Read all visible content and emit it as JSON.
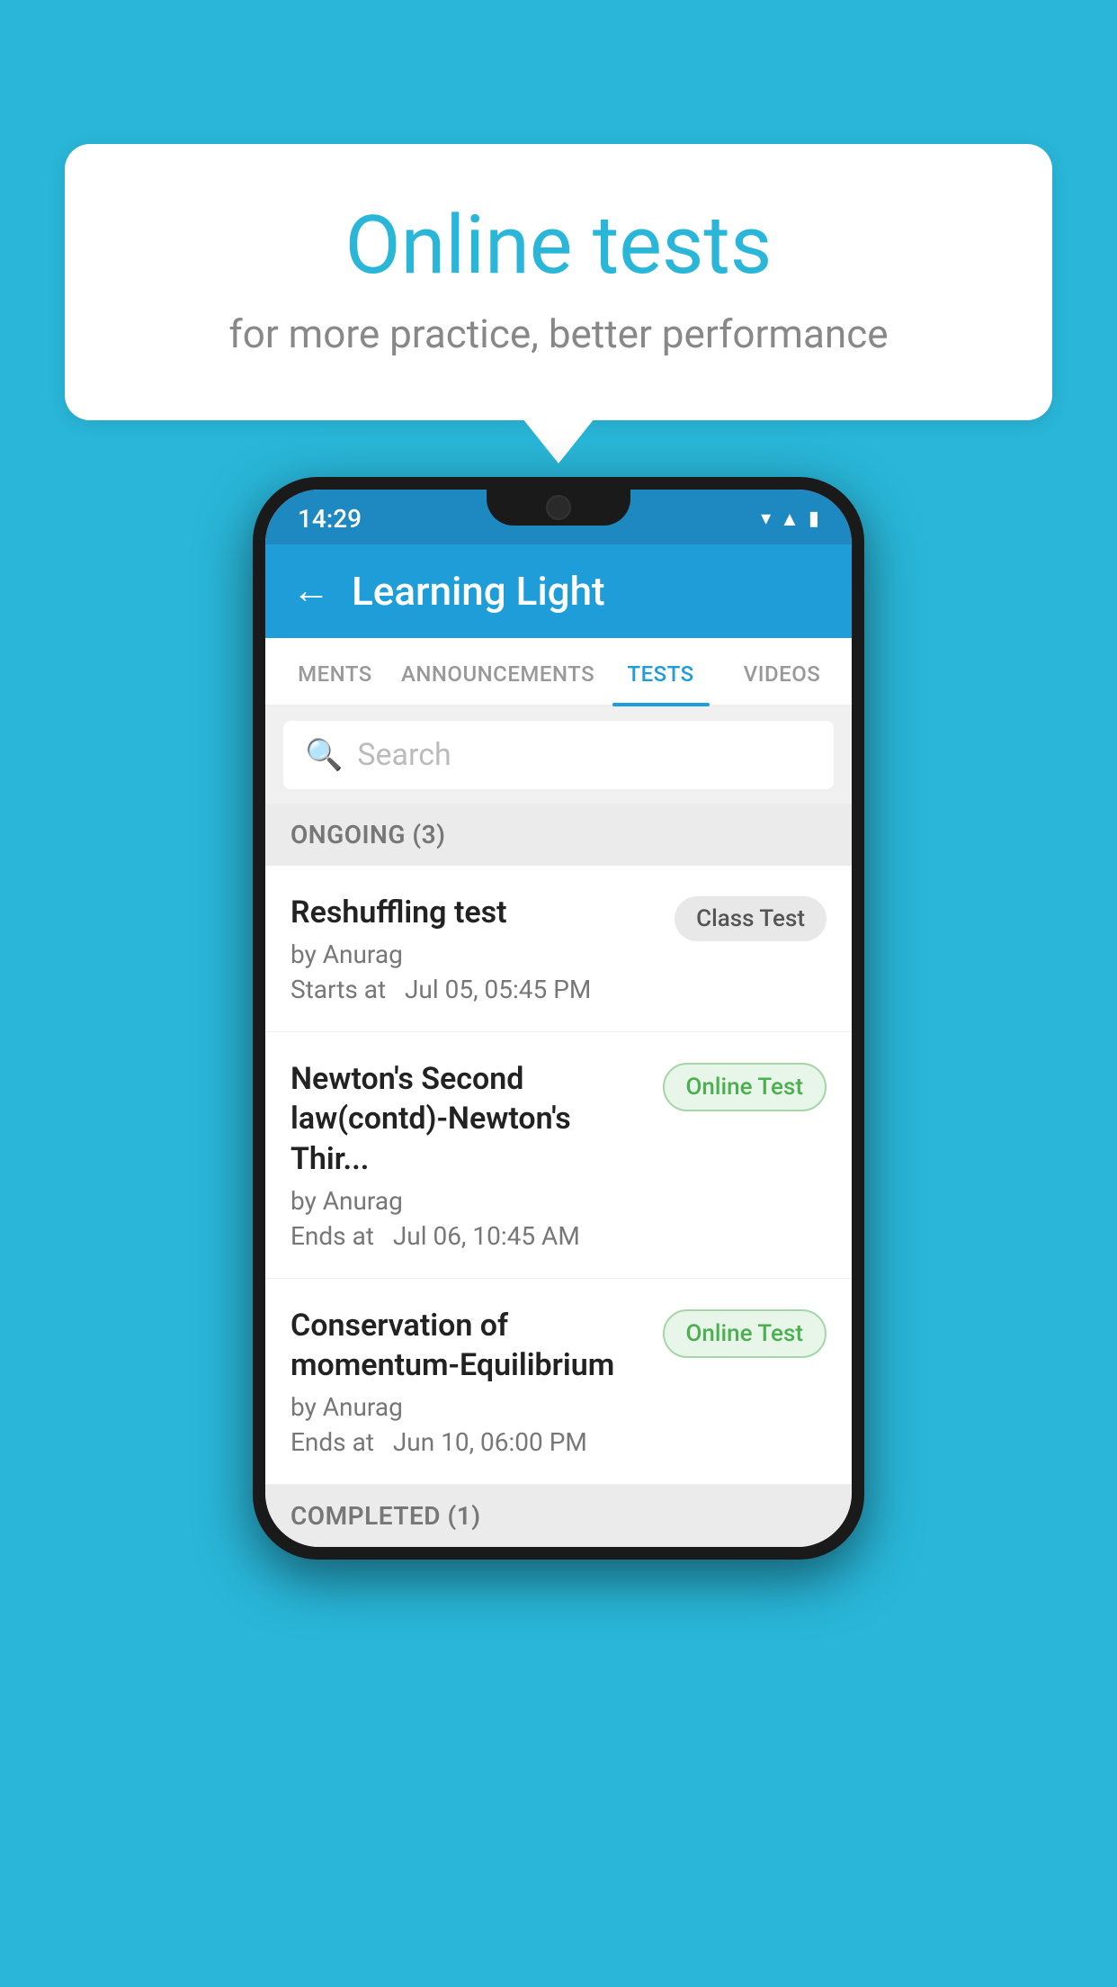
{
  "background_color": "#29b6d8",
  "bubble": {
    "title": "Online tests",
    "subtitle": "for more practice, better performance"
  },
  "status_bar": {
    "time": "14:29",
    "icons": [
      "wifi",
      "signal",
      "battery"
    ]
  },
  "header": {
    "title": "Learning Light",
    "back_label": "←"
  },
  "tabs": [
    {
      "label": "MENTS",
      "active": false
    },
    {
      "label": "ANNOUNCEMENTS",
      "active": false
    },
    {
      "label": "TESTS",
      "active": true
    },
    {
      "label": "VIDEOS",
      "active": false
    }
  ],
  "search": {
    "placeholder": "Search"
  },
  "ongoing_section": {
    "label": "ONGOING (3)"
  },
  "test_items": [
    {
      "name": "Reshuffling test",
      "by": "by Anurag",
      "time_label": "Starts at",
      "time": "Jul 05, 05:45 PM",
      "badge": "Class Test",
      "badge_type": "class"
    },
    {
      "name": "Newton's Second law(contd)-Newton's Thir...",
      "by": "by Anurag",
      "time_label": "Ends at",
      "time": "Jul 06, 10:45 AM",
      "badge": "Online Test",
      "badge_type": "online"
    },
    {
      "name": "Conservation of momentum-Equilibrium",
      "by": "by Anurag",
      "time_label": "Ends at",
      "time": "Jun 10, 06:00 PM",
      "badge": "Online Test",
      "badge_type": "online"
    }
  ],
  "completed_section": {
    "label": "COMPLETED (1)"
  }
}
